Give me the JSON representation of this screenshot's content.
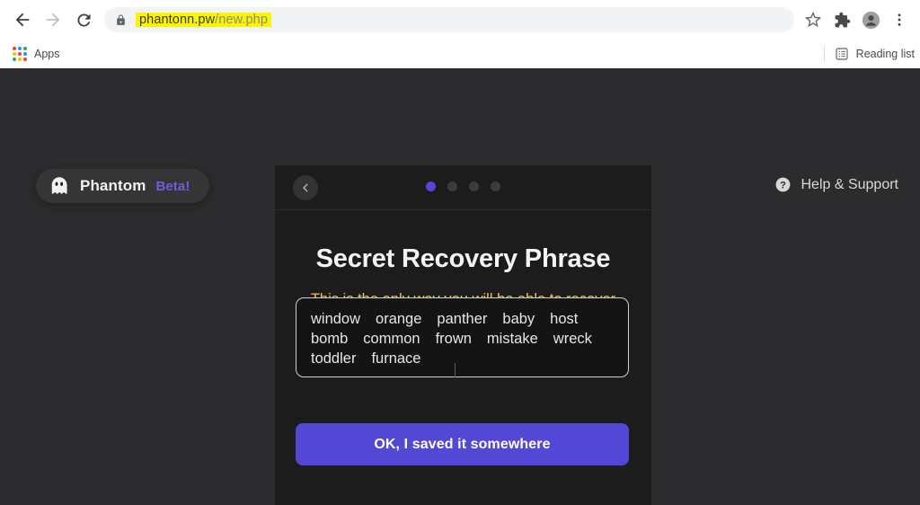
{
  "browser": {
    "back_label": "Back",
    "forward_label": "Forward",
    "reload_label": "Reload",
    "url_host": "phantonn.pw",
    "url_path": "/new.php",
    "url_full": "phantonn.pw/new.php",
    "lock_icon": "lock-icon",
    "highlight_color": "#fdf500",
    "bookmark_star_icon": "star-icon",
    "extensions_icon": "puzzle-piece-icon",
    "profile_icon": "profile-avatar-icon",
    "menu_icon": "three-dot-menu-icon",
    "bookmarks": {
      "apps_label": "Apps",
      "apps_icon": "apps-grid-icon",
      "reading_list_label": "Reading list",
      "reading_list_icon": "reading-list-icon"
    }
  },
  "page": {
    "background_color": "#2c2c2e",
    "brand": {
      "logo_icon": "phantom-ghost-icon",
      "name": "Phantom",
      "beta": "Beta!",
      "beta_color": "#6b5fe0"
    },
    "help": {
      "icon": "question-mark-circle-icon",
      "label": "Help & Support"
    }
  },
  "card": {
    "background_color": "#1c1c1c",
    "back_button_icon": "chevron-left-icon",
    "pagination": {
      "total": 4,
      "active_index": 1,
      "active_color": "#5348d6",
      "inactive_color": "#3c3c3e"
    },
    "title": "Secret Recovery Phrase",
    "warning": "This is the only way you will be able to recover your account. Please store it somewhere safe!",
    "warning_color": "#e5c55a",
    "seed_phrase": {
      "words": [
        "window",
        "orange",
        "panther",
        "baby",
        "host",
        "bomb",
        "common",
        "frown",
        "mistake",
        "wreck",
        "toddler",
        "furnace"
      ],
      "word_count": 12
    },
    "primary_button": {
      "label": "OK, I saved it somewhere",
      "color": "#5348d6"
    }
  }
}
